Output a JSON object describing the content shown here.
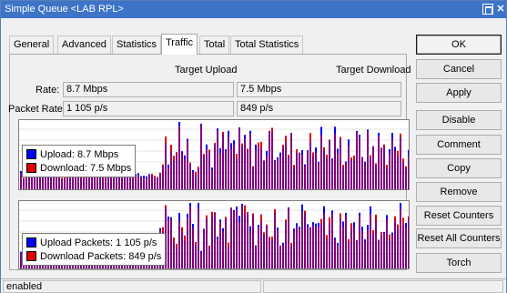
{
  "window": {
    "title": "Simple Queue <LAB RPL>"
  },
  "tabs": [
    {
      "label": "General",
      "active": false
    },
    {
      "label": "Advanced",
      "active": false
    },
    {
      "label": "Statistics",
      "active": false
    },
    {
      "label": "Traffic",
      "active": true
    },
    {
      "label": "Total",
      "active": false
    },
    {
      "label": "Total Statistics",
      "active": false
    }
  ],
  "traffic": {
    "headers": {
      "upload": "Target Upload",
      "download": "Target Download"
    },
    "rate": {
      "label": "Rate:",
      "upload": "8.7 Mbps",
      "download": "7.5 Mbps"
    },
    "packet_rate": {
      "label": "Packet Rate:",
      "upload": "1 105 p/s",
      "download": "849 p/s"
    }
  },
  "graphs": {
    "colors": {
      "upload": "#0000ff",
      "download": "#e00000",
      "overlap": "#800080"
    },
    "rate": {
      "legend": [
        {
          "color": "#0000ff",
          "text": "Upload:  8.7 Mbps"
        },
        {
          "color": "#e00000",
          "text": "Download:  7.5 Mbps"
        }
      ]
    },
    "packets": {
      "legend": [
        {
          "color": "#0000ff",
          "text": "Upload Packets:  1 105 p/s"
        },
        {
          "color": "#e00000",
          "text": "Download Packets:  849 p/s"
        }
      ]
    }
  },
  "buttons": [
    {
      "label": "OK",
      "name": "ok-button"
    },
    {
      "label": "Cancel",
      "name": "cancel-button"
    },
    {
      "label": "Apply",
      "name": "apply-button"
    },
    {
      "label": "Disable",
      "name": "disable-button"
    },
    {
      "label": "Comment",
      "name": "comment-button"
    },
    {
      "label": "Copy",
      "name": "copy-button"
    },
    {
      "label": "Remove",
      "name": "remove-button"
    },
    {
      "label": "Reset Counters",
      "name": "reset-counters-button"
    },
    {
      "label": "Reset All Counters",
      "name": "reset-all-counters-button"
    },
    {
      "label": "Torch",
      "name": "torch-button"
    }
  ],
  "status": {
    "text": "enabled"
  }
}
